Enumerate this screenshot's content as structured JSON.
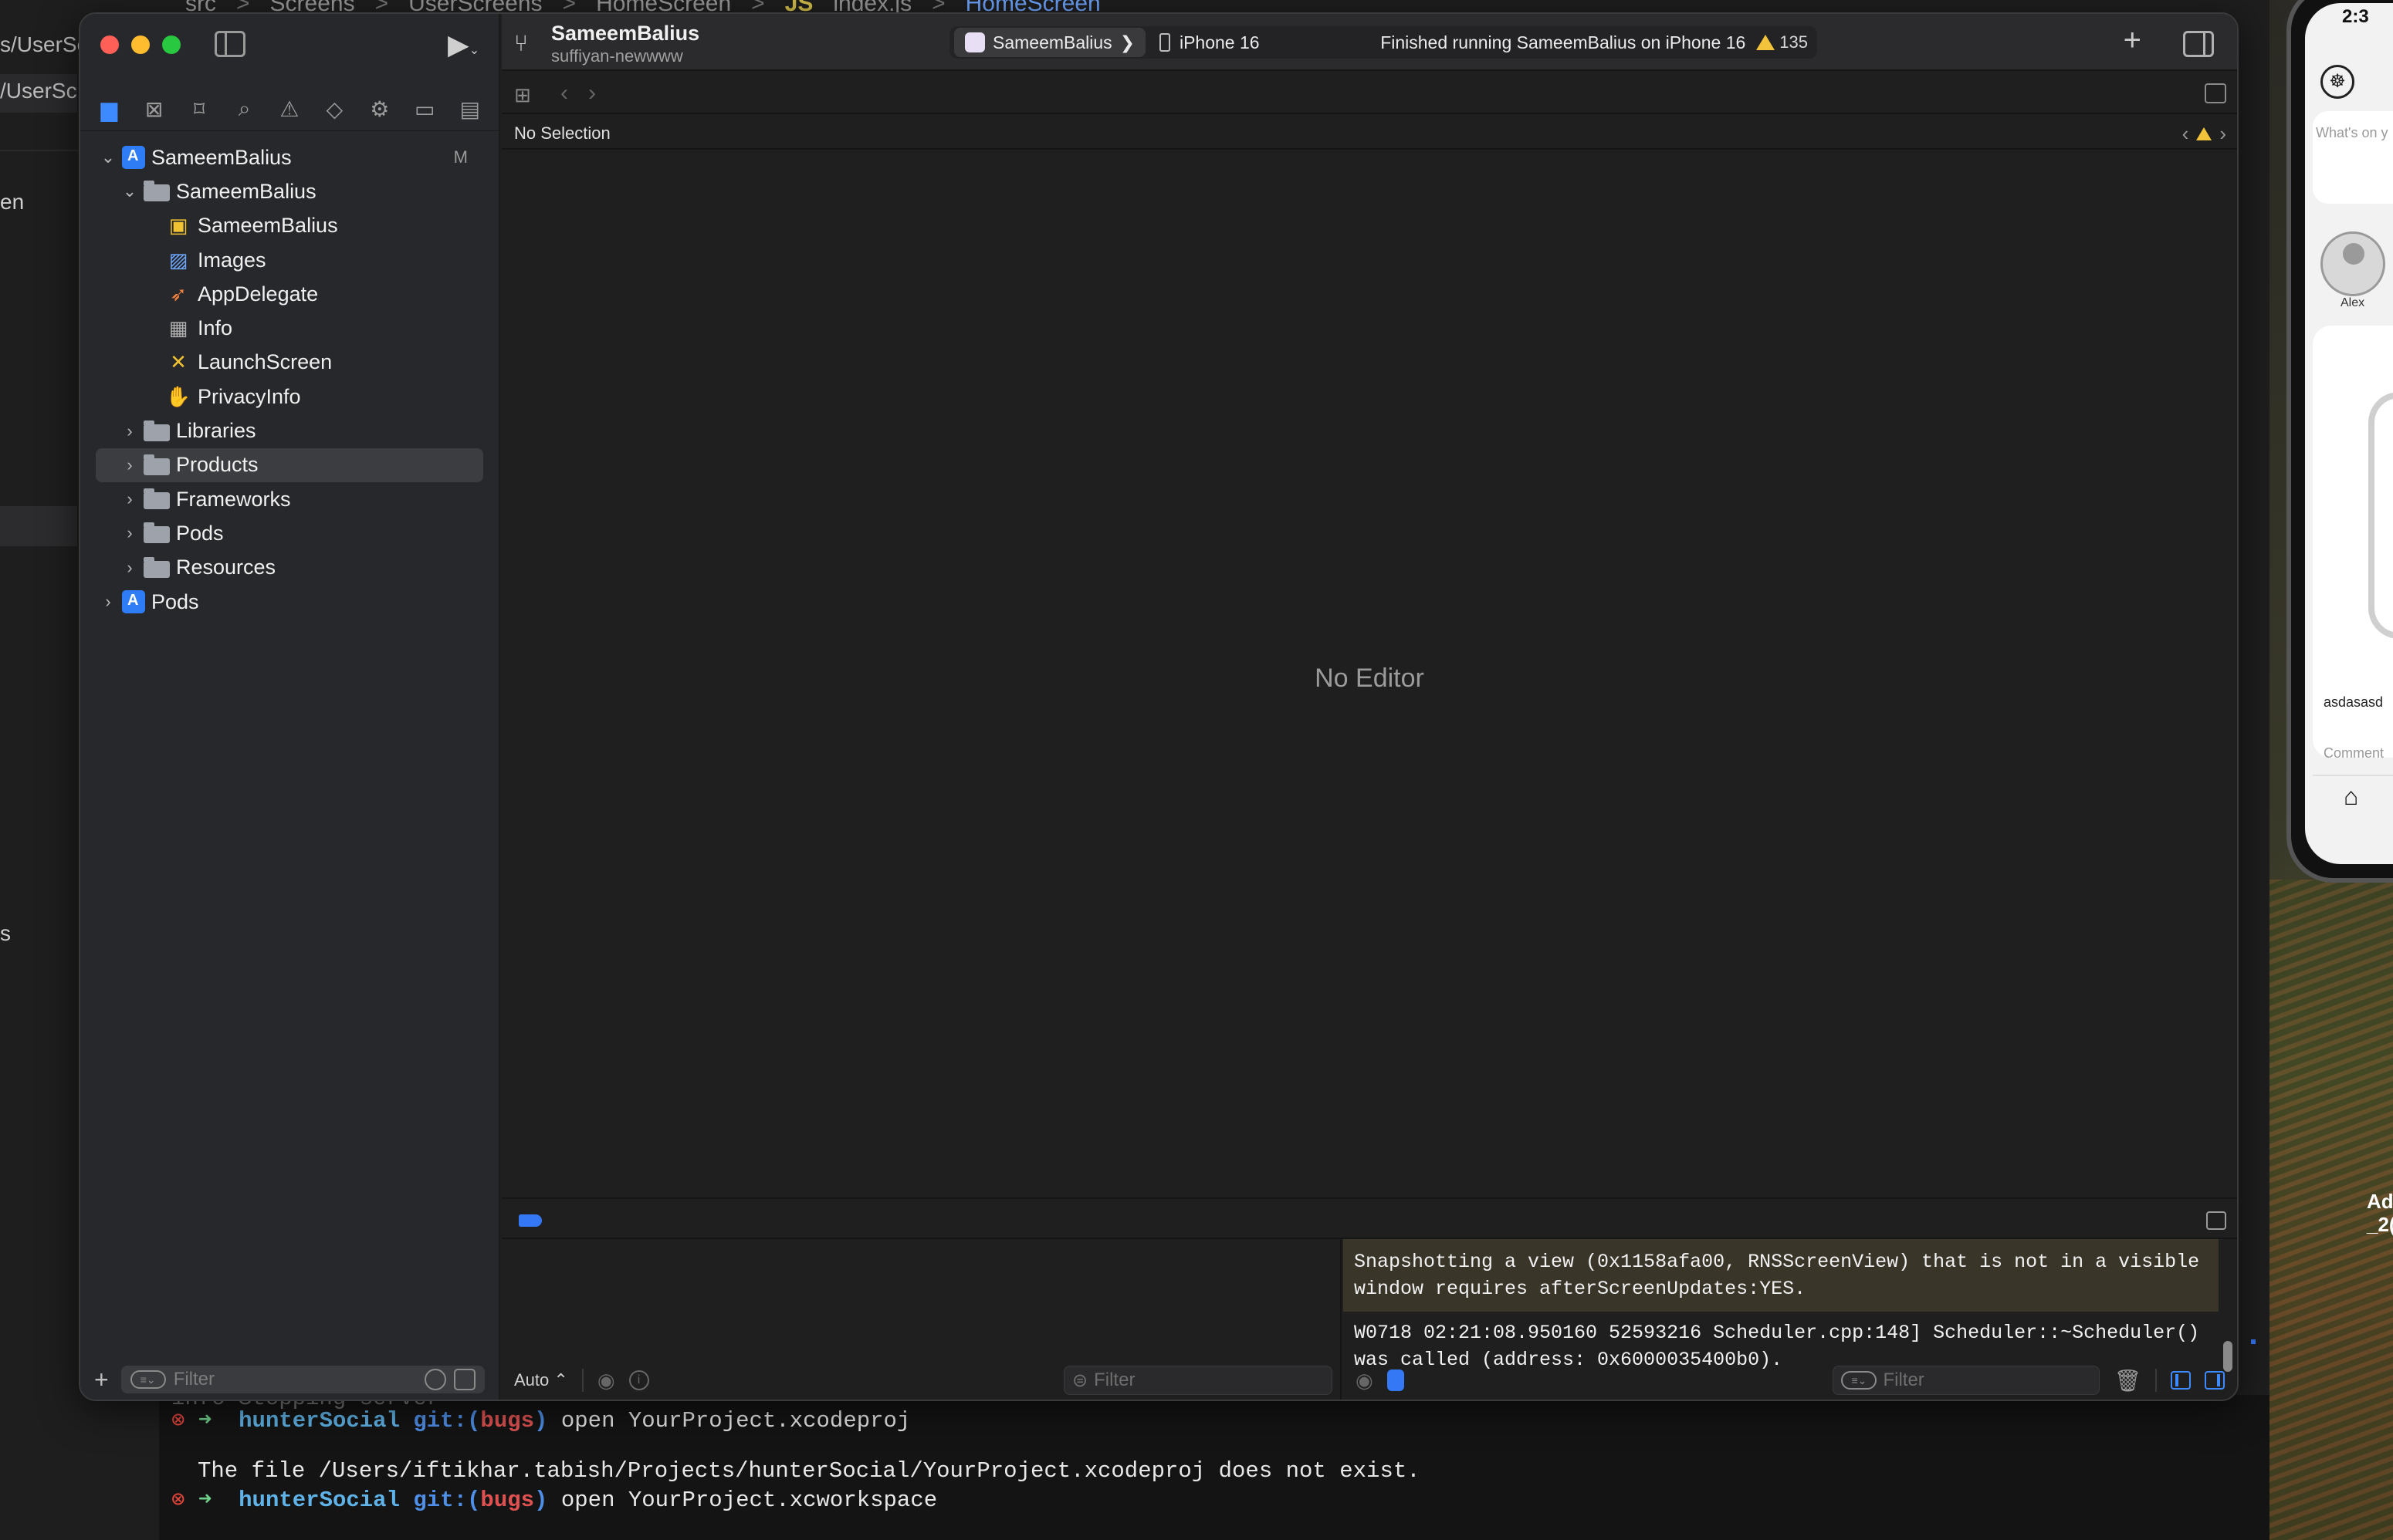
{
  "background_editor": {
    "breadcrumb": [
      "src",
      "Screens",
      "UserScreens",
      "HomeScreen",
      "JS",
      "index.js",
      "HomeScreen"
    ],
    "left_tab1": "s/UserSc",
    "left_tab2": "/UserSc",
    "left_text_en": "en",
    "left_text_s": "s"
  },
  "terminal": {
    "line0": "info Stopping server",
    "line1_dir": "hunterSocial",
    "line1_git": "git:(",
    "line1_branch": "bugs",
    "line1_close": ")",
    "line1_cmd": "open YourProject.xcodeproj",
    "line2": "The file /Users/iftikhar.tabish/Projects/hunterSocial/YourProject.xcodeproj does not exist.",
    "line3_dir": "hunterSocial",
    "line3_git": "git:(",
    "line3_branch": "bugs",
    "line3_close": ")",
    "line3_cmd": "open YourProject.xcworkspace",
    "x_glyph": "⊗",
    "arrow_glyph": "➜"
  },
  "xcode": {
    "toolbar": {
      "scheme_title": "SameemBalius",
      "branch": "suffiyan-newwww",
      "target": "SameemBalius",
      "target_chevron": "❯",
      "device": "iPhone 16",
      "run_status": "Finished running SameemBalius on iPhone 16",
      "warnings": "135",
      "add": "+"
    },
    "navigator": {
      "items": [
        {
          "label": "SameemBalius",
          "badge": "M"
        },
        {
          "label": "SameemBalius"
        },
        {
          "label": "SameemBalius"
        },
        {
          "label": "Images"
        },
        {
          "label": "AppDelegate"
        },
        {
          "label": "Info"
        },
        {
          "label": "LaunchScreen"
        },
        {
          "label": "PrivacyInfo"
        },
        {
          "label": "Libraries"
        },
        {
          "label": "Products"
        },
        {
          "label": "Frameworks"
        },
        {
          "label": "Pods"
        },
        {
          "label": "Resources"
        },
        {
          "label": "Pods"
        }
      ],
      "filter_placeholder": "Filter",
      "add": "+"
    },
    "jumpbar": {
      "no_selection": "No Selection"
    },
    "editor": {
      "empty_text": "No Editor"
    },
    "variables": {
      "mode": "Auto ⌃",
      "filter_placeholder": "Filter"
    },
    "console": {
      "message1": "Snapshotting a view (0x1158afa00, RNSScreenView) that is not in a visible window requires afterScreenUpdates:YES.",
      "message2": "W0718 02:21:08.950160 52593216 Scheduler.cpp:148] Scheduler::~Scheduler() was called (address: 0x6000035400b0).",
      "filter_placeholder": "Filter"
    }
  },
  "simulator": {
    "time": "2:3",
    "whats_on": "What's on y",
    "user": "Alex",
    "post_text": "asdasasd",
    "comment": "Comment",
    "side_text_line1": "Ad",
    "side_text_line2": "_2("
  }
}
